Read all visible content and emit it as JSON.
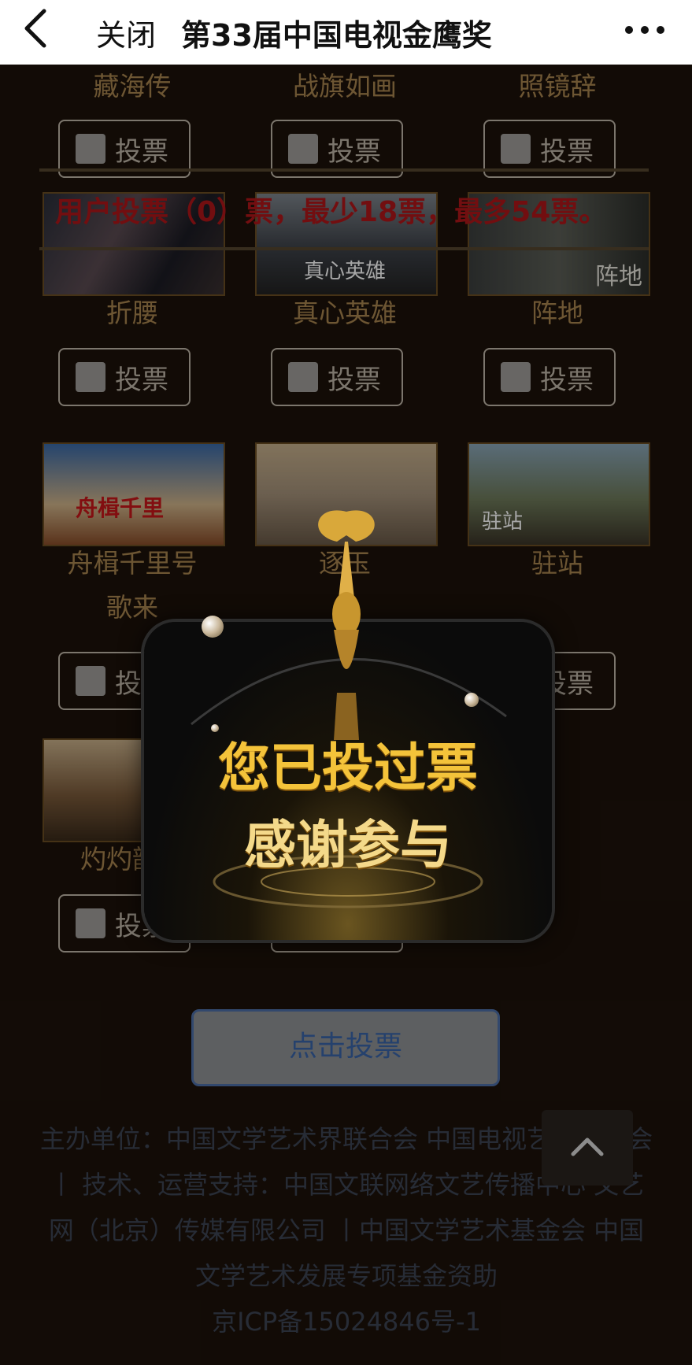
{
  "topbar": {
    "close_label": "关闭",
    "title": "第33届中国电视金鹰奖"
  },
  "shows": [
    {
      "name": "藏海传",
      "vote_label": "投票"
    },
    {
      "name": "战旗如画",
      "vote_label": "投票"
    },
    {
      "name": "照镜辞",
      "vote_label": "投票"
    },
    {
      "name": "折腰",
      "vote_label": "投票"
    },
    {
      "name": "真心英雄",
      "vote_label": "投票"
    },
    {
      "name": "阵地",
      "vote_label": "投票"
    },
    {
      "name": "舟楫千里号歌来",
      "vote_label": "投票"
    },
    {
      "name": "逐玉",
      "vote_label": "投票"
    },
    {
      "name": "驻站",
      "vote_label": "投票"
    },
    {
      "name": "灼灼韶华",
      "vote_label": "投票"
    },
    {
      "name": "",
      "vote_label": "投票"
    }
  ],
  "poster_texts": {
    "p4": "真心英雄",
    "p5": "阵地",
    "p6": "舟楫千里",
    "p8": "驻站"
  },
  "vote_banner": "用户投票（0）票，最少18票，最多54票。",
  "submit_label": "点击投票",
  "footer": {
    "line1": "主办单位：中国文学艺术界联合会  中国电视艺术家协会  丨 技术、运营支持：中国文联网络文艺传播中心  文艺网（北京）传媒有限公司 丨中国文学艺术基金会 中国文学艺术发展专项基金资助",
    "icp": "京ICP备15024846号-1"
  },
  "modal": {
    "line1": "您已投过票",
    "line2": "感谢参与"
  },
  "colors": {
    "background": "#1d120a",
    "accent_gold": "#f4c33a",
    "banner_red": "#b0161a",
    "submit_blue": "#3a64a8"
  }
}
